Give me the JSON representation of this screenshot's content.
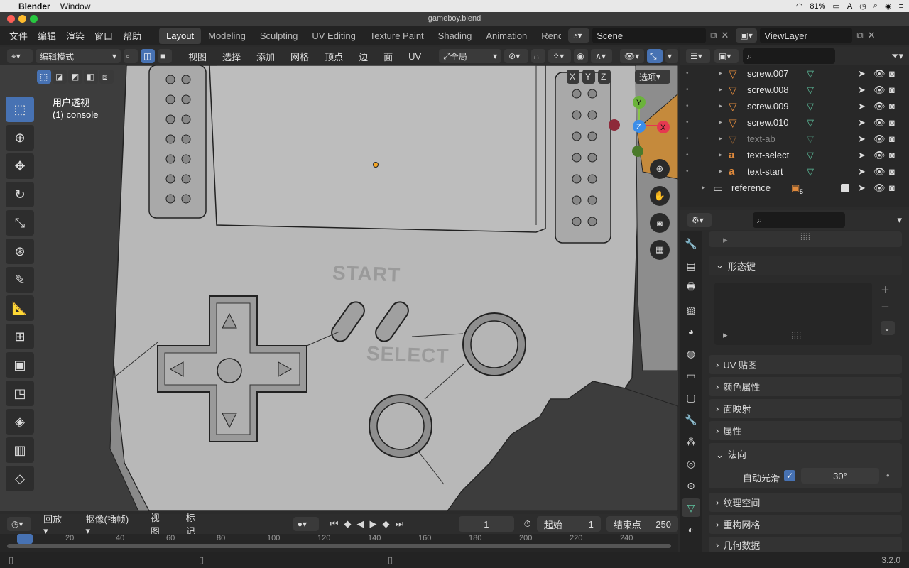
{
  "mac": {
    "app": "Blender",
    "menu": "Window",
    "battery": "81%"
  },
  "title": "gameboy.blend",
  "topmenu": [
    "文件",
    "编辑",
    "渲染",
    "窗口",
    "帮助"
  ],
  "workspaces": [
    "Layout",
    "Modeling",
    "Sculpting",
    "UV Editing",
    "Texture Paint",
    "Shading",
    "Animation",
    "Rend"
  ],
  "scene": "Scene",
  "viewlayer": "ViewLayer",
  "header": {
    "mode": "编辑模式",
    "menus": [
      "视图",
      "选择",
      "添加",
      "网格",
      "顶点",
      "边",
      "面",
      "UV"
    ],
    "transform": "全局",
    "options": "选项",
    "axes": [
      "X",
      "Y",
      "Z"
    ]
  },
  "viewport": {
    "view_name": "用户透视",
    "object": "(1) console",
    "start_text": "START",
    "select_text": "SELECT"
  },
  "outliner": [
    {
      "name": "screw.007",
      "icon": "mesh-icon"
    },
    {
      "name": "screw.008",
      "icon": "mesh-icon"
    },
    {
      "name": "screw.009",
      "icon": "mesh-icon"
    },
    {
      "name": "screw.010",
      "icon": "mesh-icon"
    },
    {
      "name": "text-ab",
      "icon": "mesh-icon",
      "dim": true
    },
    {
      "name": "text-select",
      "icon": "text-icon"
    },
    {
      "name": "text-start",
      "icon": "text-icon"
    },
    {
      "name": "reference",
      "icon": "collection-icon",
      "badge": "5"
    }
  ],
  "properties": {
    "shape_keys": "形态键",
    "uv_maps": "UV 贴图",
    "color_attributes": "颜色属性",
    "face_maps": "面映射",
    "attributes": "属性",
    "normals": "法向",
    "auto_smooth_label": "自动光滑",
    "auto_smooth_angle": "30°",
    "texture_space": "纹理空间",
    "remesh": "重构网格",
    "geometry_data": "几何数据"
  },
  "timeline": {
    "playback": "回放",
    "keying": "抠像(插帧)",
    "view": "视图",
    "marker": "标记",
    "current_frame": "1",
    "start_label": "起始",
    "start": "1",
    "end_label": "结束点",
    "end": "250",
    "ruler": [
      "20",
      "40",
      "60",
      "80",
      "100",
      "120",
      "140",
      "160",
      "180",
      "200",
      "220",
      "240"
    ]
  },
  "version": "3.2.0",
  "colors": {
    "accent": "#4772b3",
    "mesh_orange": "#e08a3c",
    "mesh_green": "#5ec4a0"
  }
}
